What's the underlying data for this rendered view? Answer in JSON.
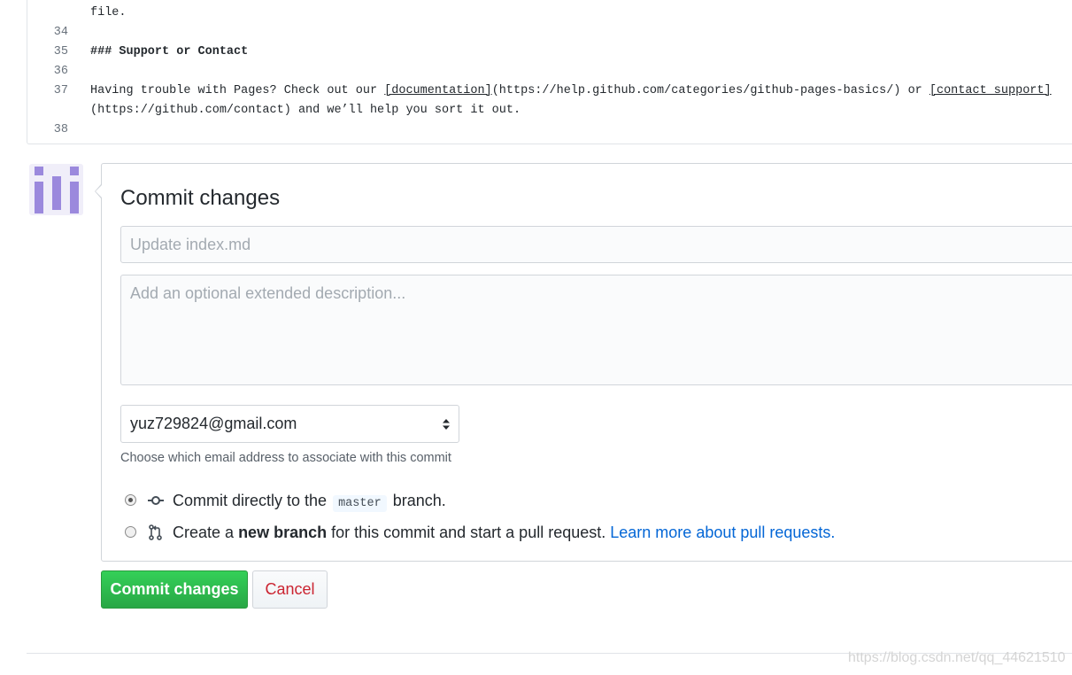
{
  "editor": {
    "lines": [
      {
        "num": "",
        "text": "file."
      },
      {
        "num": "34",
        "text": ""
      },
      {
        "num": "35",
        "text": "### Support or Contact"
      },
      {
        "num": "36",
        "text": ""
      },
      {
        "num": "37",
        "parts": [
          "Having trouble with Pages? Check out our ",
          "[documentation]",
          "(https://help.github.com/categories/github-pages-basics/) or ",
          "[contact support]"
        ]
      },
      {
        "num": "",
        "text": "(https://github.com/contact) and we’ll help you sort it out."
      },
      {
        "num": "38",
        "text": ""
      }
    ]
  },
  "commit": {
    "title": "Commit changes",
    "summary_placeholder": "Update index.md",
    "description_placeholder": "Add an optional extended description...",
    "email_selected": "yuz729824@gmail.com",
    "email_hint": "Choose which email address to associate with this commit",
    "option_direct": {
      "before": "Commit directly to the",
      "branch": "master",
      "after": "branch."
    },
    "option_new_branch": {
      "before": "Create a",
      "bold": "new branch",
      "after": "for this commit and start a pull request.",
      "link": "Learn more about pull requests."
    },
    "selected_option": "direct"
  },
  "buttons": {
    "commit": "Commit changes",
    "cancel": "Cancel"
  },
  "watermark": "https://blog.csdn.net/qq_44621510",
  "colors": {
    "primary_green": "#28a745",
    "cancel_red": "#cb2431",
    "link_blue": "#0366d6",
    "avatar_purple": "#9b89dd"
  }
}
